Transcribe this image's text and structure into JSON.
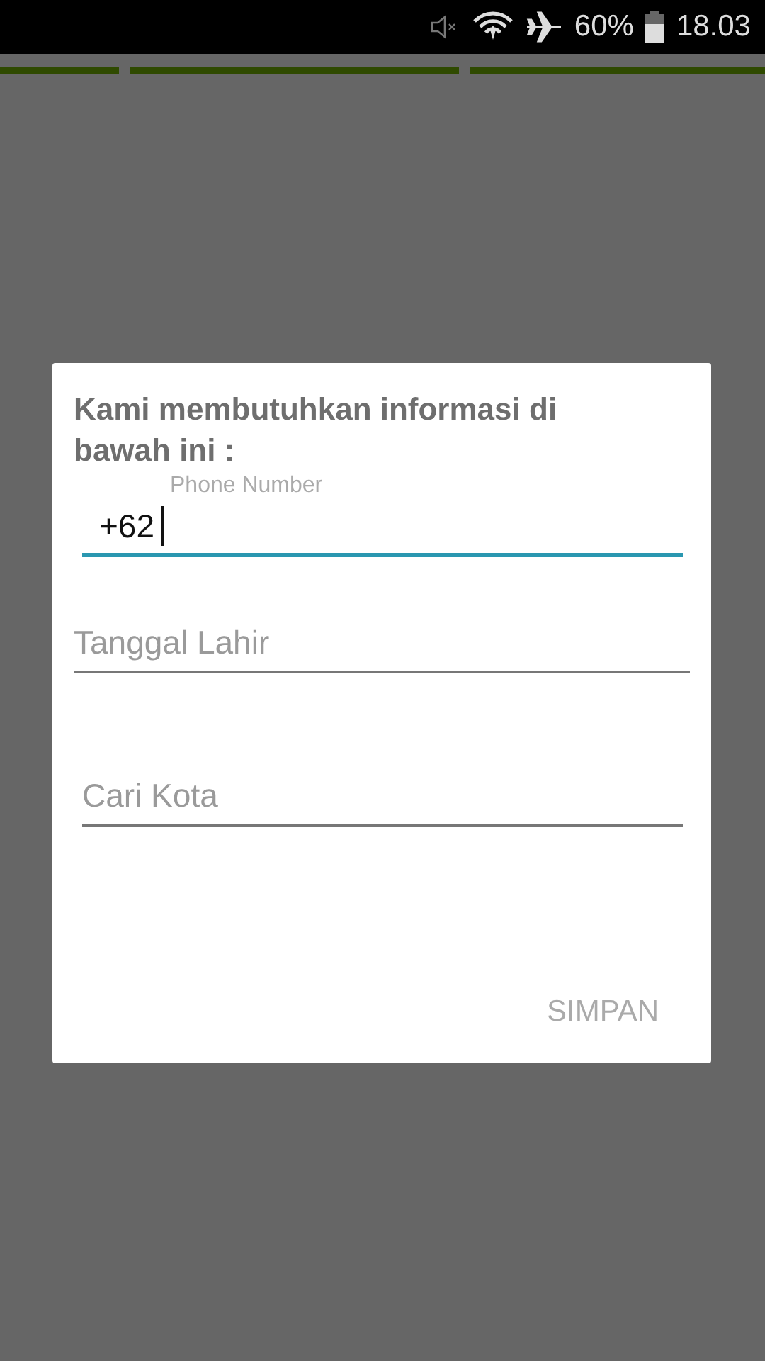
{
  "status_bar": {
    "battery": "60%",
    "time": "18.03"
  },
  "dialog": {
    "title": "Kami membutuhkan informasi di bawah ini :",
    "fields": [
      {
        "label": "Phone Number",
        "value": "+62",
        "focused": true
      },
      {
        "placeholder": "Tanggal Lahir",
        "focused": false
      },
      {
        "placeholder": "Cari Kota",
        "focused": false
      }
    ],
    "button": {
      "label": "SIMPAN",
      "disabled": true
    }
  }
}
